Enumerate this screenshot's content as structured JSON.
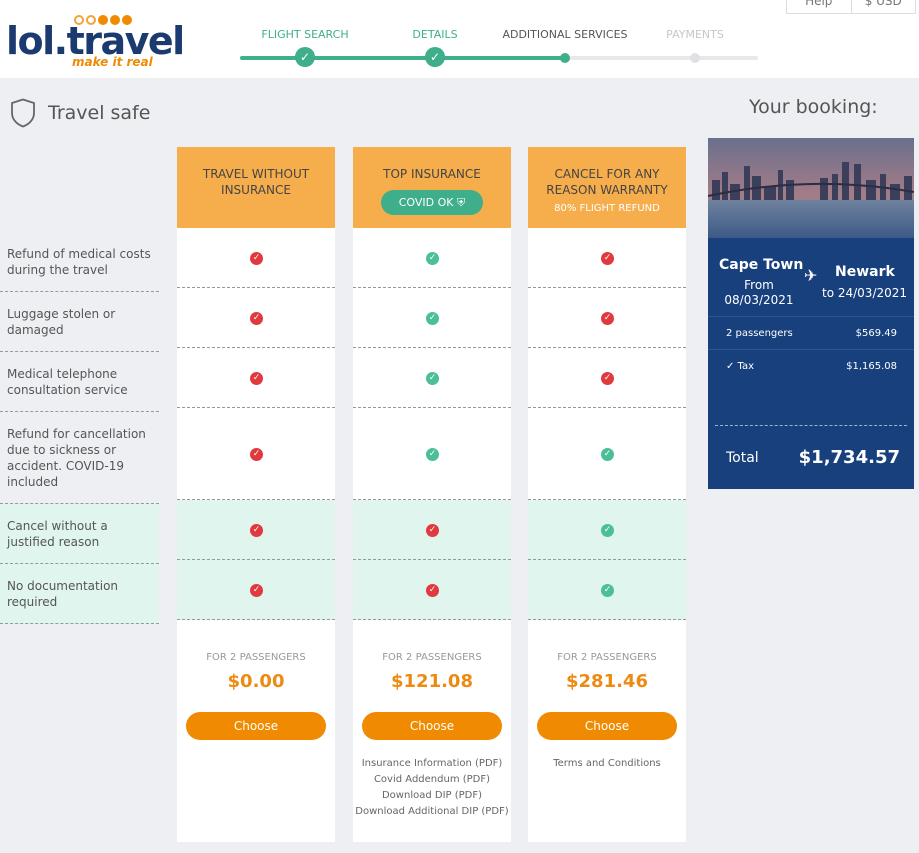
{
  "header": {
    "logo_text": "lol.travel",
    "logo_tagline": "make it real",
    "help_label": "Help",
    "currency_label": "$ USD",
    "steps": [
      {
        "label": "FLIGHT SEARCH",
        "state": "done"
      },
      {
        "label": "DETAILS",
        "state": "done"
      },
      {
        "label": "ADDITIONAL SERVICES",
        "state": "current"
      },
      {
        "label": "PAYMENTS",
        "state": "future"
      }
    ]
  },
  "section": {
    "title": "Travel safe",
    "icon": "shield-icon"
  },
  "features": [
    "Refund of medical costs during the travel",
    "Luggage stolen or damaged",
    "Medical telephone consultation service",
    "Refund for cancellation due to sickness or accident. COVID-19 included",
    "Cancel without a justified reason",
    "No documentation required"
  ],
  "plans": [
    {
      "name": "TRAVEL WITHOUT INSURANCE",
      "badge": "",
      "note": "",
      "marks": [
        "no",
        "no",
        "no",
        "no",
        "no",
        "no"
      ],
      "for_passengers": "FOR 2 PASSENGERS",
      "price": "$0.00",
      "choose_label": "Choose",
      "links": []
    },
    {
      "name": "TOP INSURANCE",
      "badge": "COVID OK",
      "note": "",
      "marks": [
        "yes",
        "yes",
        "yes",
        "yes",
        "no",
        "no"
      ],
      "for_passengers": "FOR 2 PASSENGERS",
      "price": "$121.08",
      "choose_label": "Choose",
      "links": [
        "Insurance Information (PDF)",
        "Covid Addendum (PDF)",
        "Download DIP (PDF)",
        "Download Additional DIP (PDF)"
      ]
    },
    {
      "name": "CANCEL FOR ANY REASON WARRANTY",
      "badge": "",
      "note": "80% FLIGHT REFUND",
      "marks": [
        "no",
        "no",
        "no",
        "yes",
        "yes",
        "yes"
      ],
      "for_passengers": "FOR 2 PASSENGERS",
      "price": "$281.46",
      "choose_label": "Choose",
      "links": [
        "Terms and Conditions"
      ]
    }
  ],
  "booking": {
    "title": "Your booking:",
    "from_city": "Cape Town",
    "from_date": "From 08/03/2021",
    "to_city": "Newark",
    "to_date": "to 24/03/2021",
    "lines": [
      {
        "label": "2 passengers",
        "value": "$569.49"
      },
      {
        "label": "✓ Tax",
        "value": "$1,165.08"
      }
    ],
    "total_label": "Total",
    "total_value": "$1,734.57"
  },
  "colors": {
    "accent": "#f08a00",
    "brand": "#17407d",
    "success": "#3fae8b",
    "error": "#e0393e",
    "header_orange": "#f6ad4c"
  }
}
